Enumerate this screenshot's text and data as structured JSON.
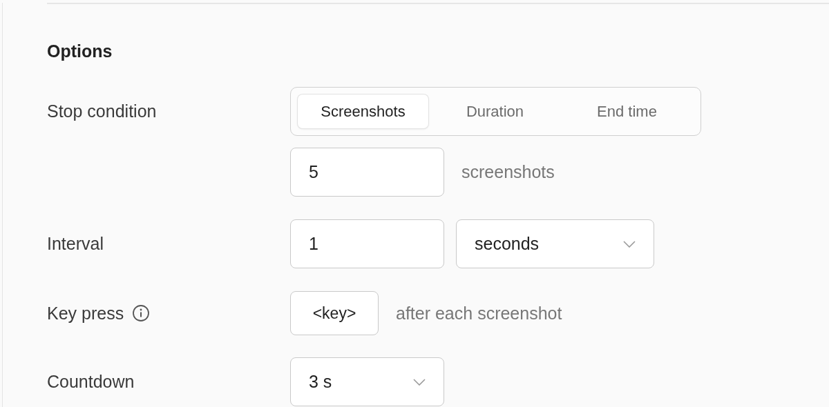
{
  "title": "Options",
  "stop_condition": {
    "label": "Stop condition",
    "segments": [
      {
        "label": "Screenshots",
        "selected": true
      },
      {
        "label": "Duration",
        "selected": false
      },
      {
        "label": "End time",
        "selected": false
      }
    ],
    "count": {
      "value": "5",
      "unit": "screenshots"
    }
  },
  "interval": {
    "label": "Interval",
    "value": "1",
    "unit": "seconds"
  },
  "key_press": {
    "label": "Key press",
    "key": "<key>",
    "suffix": "after each screenshot"
  },
  "countdown": {
    "label": "Countdown",
    "value": "3 s"
  }
}
